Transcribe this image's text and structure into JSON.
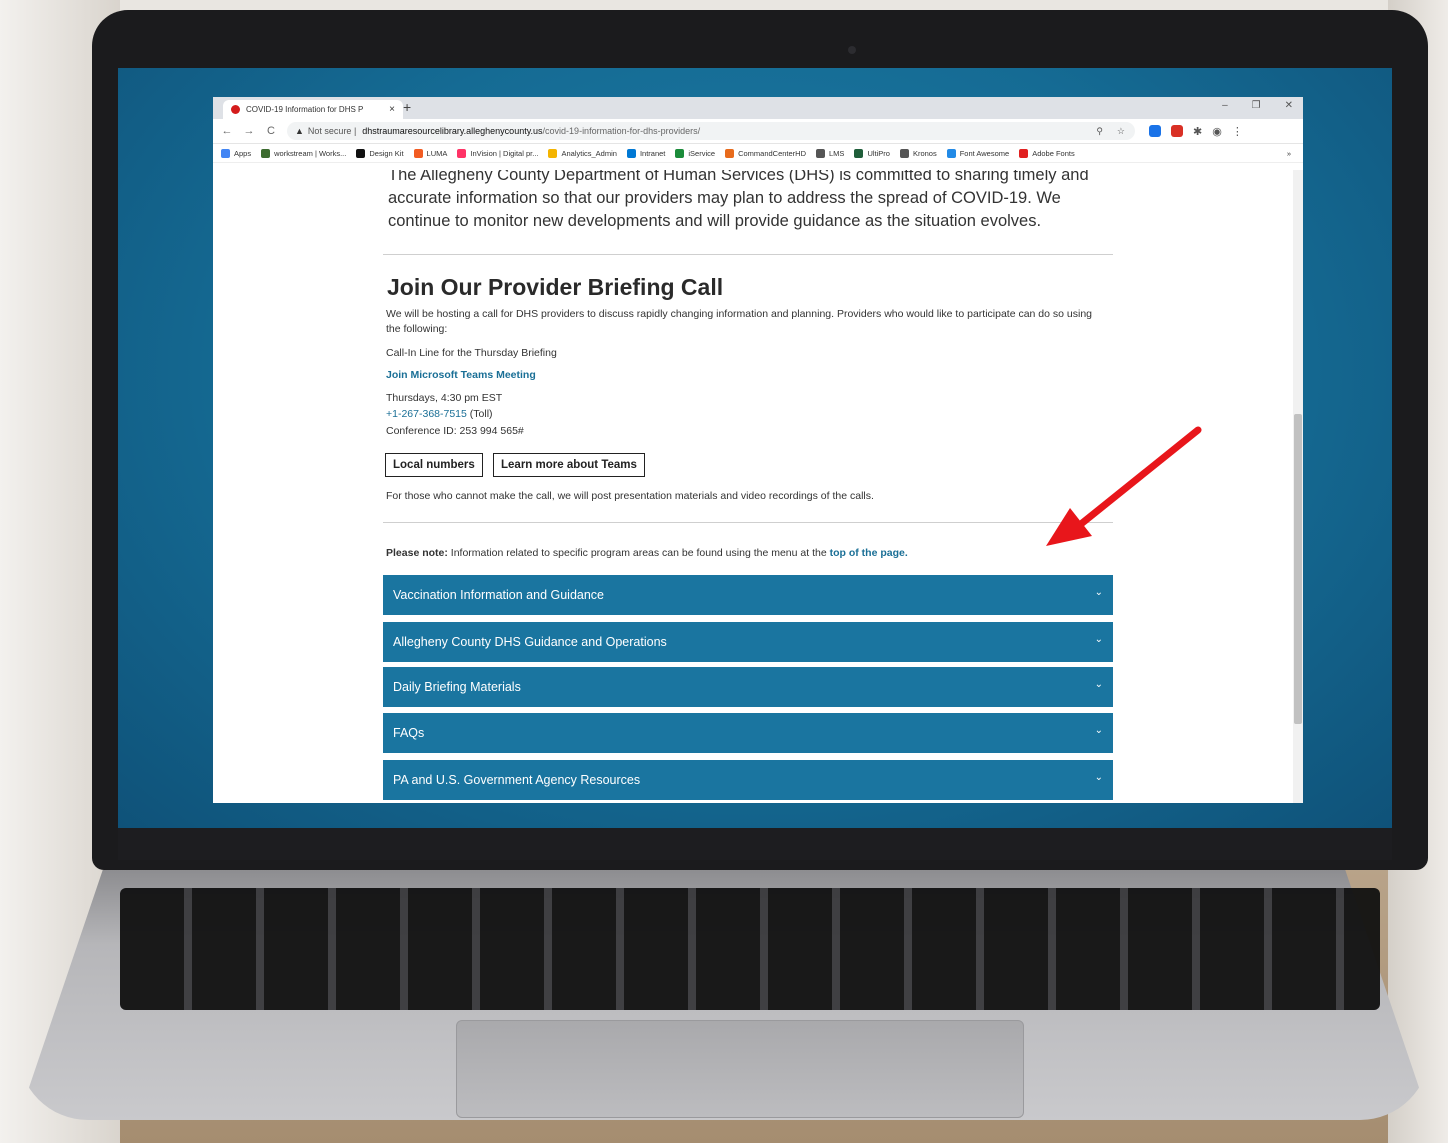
{
  "browser": {
    "tab_title": "COVID-19 Information for DHS P",
    "tab_close": "×",
    "new_tab": "+",
    "window_controls": [
      "–",
      "❐",
      "✕"
    ],
    "nav": {
      "back": "←",
      "forward": "→",
      "reload": "C"
    },
    "address": {
      "warning_glyph": "▲",
      "security_label": "Not secure |",
      "host": "dhstraumaresourcelibrary.alleghenycounty.us",
      "path": "/covid-19-information-for-dhs-providers/"
    },
    "bookmarks": [
      {
        "label": "Apps",
        "color": "#4285f4"
      },
      {
        "label": "workstream | Works...",
        "color": "#3c6b2f"
      },
      {
        "label": "Design Kit",
        "color": "#111111"
      },
      {
        "label": "LUMA",
        "color": "#f25c22"
      },
      {
        "label": "InVision | Digital pr...",
        "color": "#ff3366"
      },
      {
        "label": "Analytics_Admin",
        "color": "#f4b400"
      },
      {
        "label": "Intranet",
        "color": "#0078d4"
      },
      {
        "label": "iService",
        "color": "#1b8c3a"
      },
      {
        "label": "CommandCenterHD",
        "color": "#e86b1c"
      },
      {
        "label": "LMS",
        "color": "#555555"
      },
      {
        "label": "UltiPro",
        "color": "#1f5e3a"
      },
      {
        "label": "Kronos",
        "color": "#555555"
      },
      {
        "label": "Font Awesome",
        "color": "#228ae6"
      },
      {
        "label": "Adobe Fonts",
        "color": "#e12020"
      }
    ],
    "bookmarks_more": "»"
  },
  "page": {
    "intro": "The Allegheny County Department of Human Services (DHS) is committed to sharing timely and accurate information so that our providers may plan to address the spread of COVID-19. We continue to monitor new developments and will provide guidance as the situation evolves.",
    "section_title": "Join Our Provider Briefing Call",
    "description": "We will be hosting a call for DHS providers to discuss rapidly changing information and planning. Providers who would like to participate can do so using the following:",
    "call_in_label": "Call-In Line for the Thursday Briefing",
    "teams_link": "Join Microsoft Teams Meeting",
    "schedule": "Thursdays, 4:30 pm EST",
    "phone": "+1-267-368-7515",
    "phone_suffix": " (Toll)",
    "conference_id": "Conference ID: 253 994 565#",
    "local_numbers_button": "Local numbers",
    "learn_more_button": "Learn more about Teams",
    "post_note": "For those who cannot make the call, we will post presentation materials and video recordings of the calls.",
    "note_label": "Please note:",
    "note_text": " Information related to specific program areas can be found using the menu at the ",
    "note_link": "top of the page.",
    "accordions": [
      "Vaccination Information and Guidance",
      "Allegheny County DHS Guidance and Operations",
      "Daily Briefing Materials",
      "FAQs",
      "PA and U.S. Government Agency Resources"
    ]
  },
  "colors": {
    "accent": "#1a75a0",
    "link": "#1a6f96",
    "arrow": "#e8161b"
  }
}
